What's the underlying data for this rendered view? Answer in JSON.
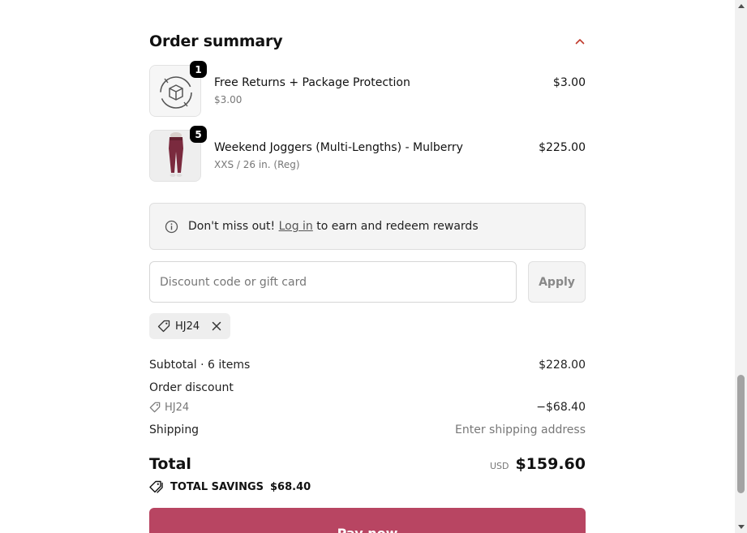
{
  "order_summary": {
    "title": "Order summary",
    "items": [
      {
        "name": "Free Returns + Package Protection",
        "sub": "$3.00",
        "price": "$3.00",
        "qty": "1",
        "icon": "package-protection-icon"
      },
      {
        "name": "Weekend Joggers (Multi-Lengths) - Mulberry",
        "sub": "XXS / 26 in. (Reg)",
        "price": "$225.00",
        "qty": "5",
        "icon": "joggers-image"
      }
    ]
  },
  "notice": {
    "prefix": "Don't miss out!",
    "link": "Log in",
    "suffix": "to earn and redeem rewards"
  },
  "discount": {
    "placeholder": "Discount code or gift card",
    "value": "",
    "apply_label": "Apply",
    "applied_code": "HJ24"
  },
  "totals": {
    "subtotal_label": "Subtotal · 6 items",
    "subtotal_value": "$228.00",
    "order_discount_label": "Order discount",
    "discount_code": "HJ24",
    "discount_value": "−$68.40",
    "shipping_label": "Shipping",
    "shipping_value": "Enter shipping address",
    "total_label": "Total",
    "currency": "USD",
    "total_value": "$159.60",
    "savings_label": "TOTAL SAVINGS",
    "savings_value": "$68.40"
  },
  "pay_button": {
    "label": "Pay now"
  },
  "colors": {
    "accent": "#b84562",
    "chevron": "#c0392b",
    "muted": "#777777",
    "jogger": "#7a2a3e"
  }
}
